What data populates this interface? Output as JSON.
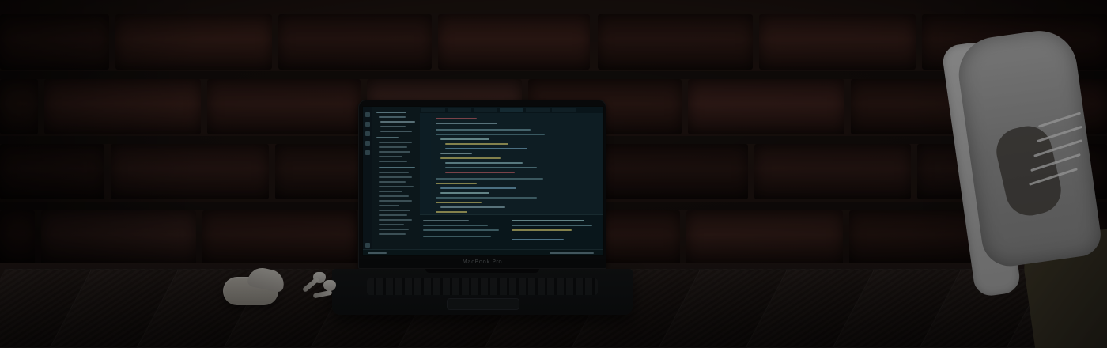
{
  "scene": {
    "laptop_brand_label": "MacBook Pro"
  },
  "colors": {
    "brick_dark": "#2a1712",
    "brick_mid": "#43251e",
    "brick_light": "#5a332a",
    "screen_background": "#1b2b31",
    "terminal_background": "#10252c",
    "table_background": "#261c18",
    "shoe_white": "#bdbdbd",
    "sock_red": "#71332a"
  },
  "icons": {
    "airpods": "earbuds-icon",
    "laptop": "laptop-icon",
    "sneaker": "sneaker-icon"
  }
}
